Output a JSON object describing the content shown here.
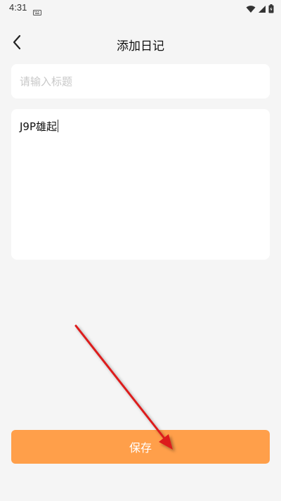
{
  "status_bar": {
    "time": "4:31"
  },
  "header": {
    "title": "添加日记",
    "back_icon": "chevron-left-icon"
  },
  "form": {
    "title_placeholder": "请输入标题",
    "title_value": "",
    "content_value": "J9P雄起"
  },
  "actions": {
    "save_label": "保存"
  },
  "colors": {
    "background": "#f5f5f5",
    "card": "#ffffff",
    "accent": "#ff9f4a",
    "annotation_arrow": "#dd1f1f"
  }
}
